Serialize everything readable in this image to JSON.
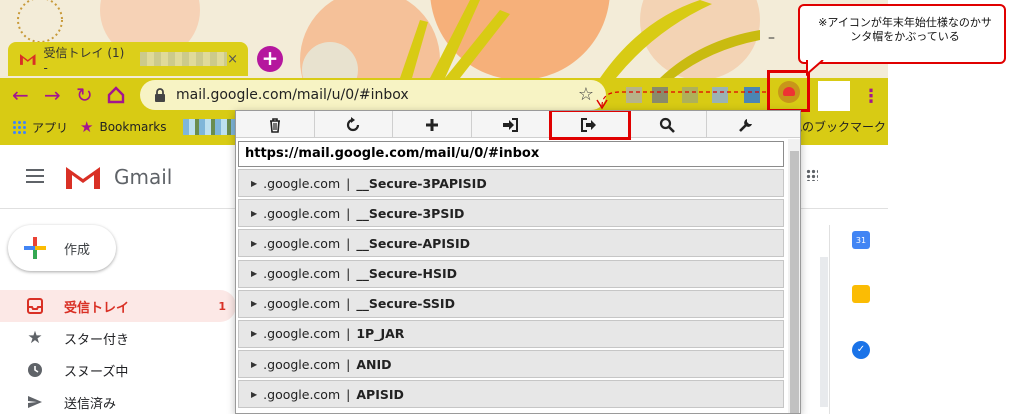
{
  "browser": {
    "tab": {
      "title": "受信トレイ (1) -",
      "close": "×"
    },
    "new_tab": "+",
    "window_minimize": "–",
    "address": {
      "url": "mail.google.com/mail/u/0/#inbox"
    },
    "bookmarks": {
      "apps": "アプリ",
      "bookmarks": "Bookmarks",
      "other": "他のブックマーク"
    },
    "accent_color": "#a3168f",
    "toolbar_color": "#d8cb14"
  },
  "annotation": {
    "text": "※アイコンが年末年始仕様なのかサンタ帽をかぶっている",
    "color": "#e00000"
  },
  "gmail": {
    "product_name": "Gmail",
    "compose_label": "作成",
    "nav": [
      {
        "label": "受信トレイ",
        "count": "1",
        "icon": "inbox-icon"
      },
      {
        "label": "スター付き",
        "count": "",
        "icon": "star-icon"
      },
      {
        "label": "スヌーズ中",
        "count": "",
        "icon": "clock-icon"
      },
      {
        "label": "送信済み",
        "count": "",
        "icon": "send-icon"
      }
    ],
    "calendar_day": "31"
  },
  "popup": {
    "toolbar": [
      "delete-icon",
      "refresh-icon",
      "add-icon",
      "import-icon",
      "export-icon",
      "search-icon",
      "settings-icon"
    ],
    "highlighted_tool": "export-icon",
    "url": "https://mail.google.com/mail/u/0/#inbox",
    "cookies": [
      {
        "domain": ".google.com",
        "name": "__Secure-3PAPISID"
      },
      {
        "domain": ".google.com",
        "name": "__Secure-3PSID"
      },
      {
        "domain": ".google.com",
        "name": "__Secure-APISID"
      },
      {
        "domain": ".google.com",
        "name": "__Secure-HSID"
      },
      {
        "domain": ".google.com",
        "name": "__Secure-SSID"
      },
      {
        "domain": ".google.com",
        "name": "1P_JAR"
      },
      {
        "domain": ".google.com",
        "name": "ANID"
      },
      {
        "domain": ".google.com",
        "name": "APISID"
      }
    ],
    "separator": "|"
  }
}
